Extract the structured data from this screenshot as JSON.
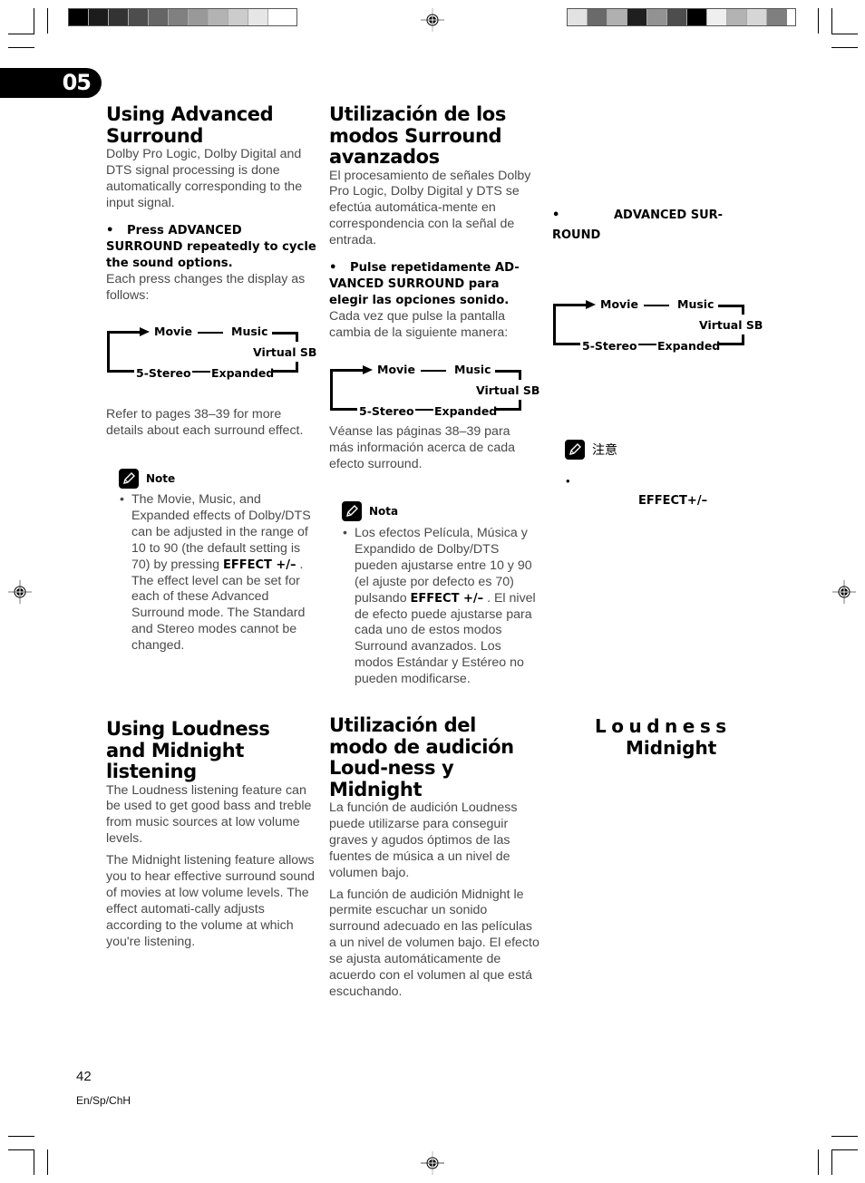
{
  "chapter": "05",
  "color_bars": {
    "left": [
      "#000000",
      "#1c1c1c",
      "#333333",
      "#4d4d4d",
      "#666666",
      "#808080",
      "#999999",
      "#b3b3b3",
      "#cccccc",
      "#e6e6e6",
      "#ffffff"
    ],
    "right": [
      "#e2e2e2",
      "#6a6a6a",
      "#b0b0b0",
      "#1f1f1f",
      "#929292",
      "#4d4d4d",
      "#000000",
      "#efefef",
      "#b3b3b3",
      "#d6d6d6",
      "#7f7f7f"
    ]
  },
  "english": {
    "section1": {
      "title": "Using Advanced Surround",
      "intro": "Dolby Pro Logic, Dolby Digital and DTS signal processing is done automatically corresponding to the input signal.",
      "step": "Press ADVANCED SURROUND repeatedly to cycle the sound options.",
      "step_detail": "Each press changes the display as follows:",
      "refer": "Refer to pages 38–39 for more details about each surround effect."
    },
    "note": {
      "label": "Note",
      "text_before": "The Movie, Music, and Expanded effects of Dolby/DTS can be adjusted in the range of 10 to 90 (the default setting is 70) by pressing ",
      "button": "EFFECT +/–",
      "text_after": " . The effect level can be set for each of these Advanced Surround mode. The Standard and Stereo modes cannot be changed."
    },
    "section2": {
      "title": "Using Loudness and Midnight listening",
      "para1": "The Loudness listening feature can be used to get good bass and treble from music sources at low volume levels.",
      "para2": "The Midnight listening feature allows you to hear effective surround sound of movies at low volume levels. The effect automati-cally adjusts according to the volume at which you're listening."
    }
  },
  "spanish": {
    "section1": {
      "title": "Utilización de los modos Surround avanzados",
      "intro": "El procesamiento de señales Dolby Pro Logic, Dolby Digital y DTS se efectúa automática-mente en correspondencia con la señal de entrada.",
      "step": "Pulse repetidamente AD-VANCED SURROUND para elegir las opciones sonido.",
      "step_detail": "Cada vez que pulse la pantalla cambia de la siguiente manera:",
      "refer": "Véanse las páginas 38–39 para más información acerca de cada efecto surround."
    },
    "note": {
      "label": "Nota",
      "text_before": "Los efectos Película, Música y Expandido de Dolby/DTS pueden ajustarse entre 10 y 90 (el ajuste por defecto es 70) pulsando ",
      "button": "EFFECT +/–",
      "text_after": " . El nivel de efecto puede ajustarse para cada uno de estos modos Surround avanzados. Los modos Estándar y Estéreo no pueden modificarse."
    },
    "section2": {
      "title": "Utilización del modo de audición Loud-ness y Midnight",
      "para1": "La función de audición Loudness puede utilizarse para conseguir graves y agudos óptimos de las fuentes de música a un nivel de volumen bajo.",
      "para2": "La función de audición Midnight le permite escuchar un sonido surround adecuado en las películas a un nivel de volumen bajo. El efecto se ajusta automáticamente de acuerdo con el volumen al que  está escuchando."
    }
  },
  "chinese": {
    "step_line1": "ADVANCED SUR-",
    "step_line2": "ROUND",
    "note_label": "注意",
    "note_button": "EFFECT+/–",
    "title_line1": "Loudness",
    "title_line2": "Midnight"
  },
  "cycle_diagram": {
    "modes": [
      "Movie",
      "Music",
      "Virtual SB",
      "Expanded",
      "5-Stereo"
    ]
  },
  "footer": {
    "page_number": "42",
    "language_code": "En/Sp/ChH"
  }
}
